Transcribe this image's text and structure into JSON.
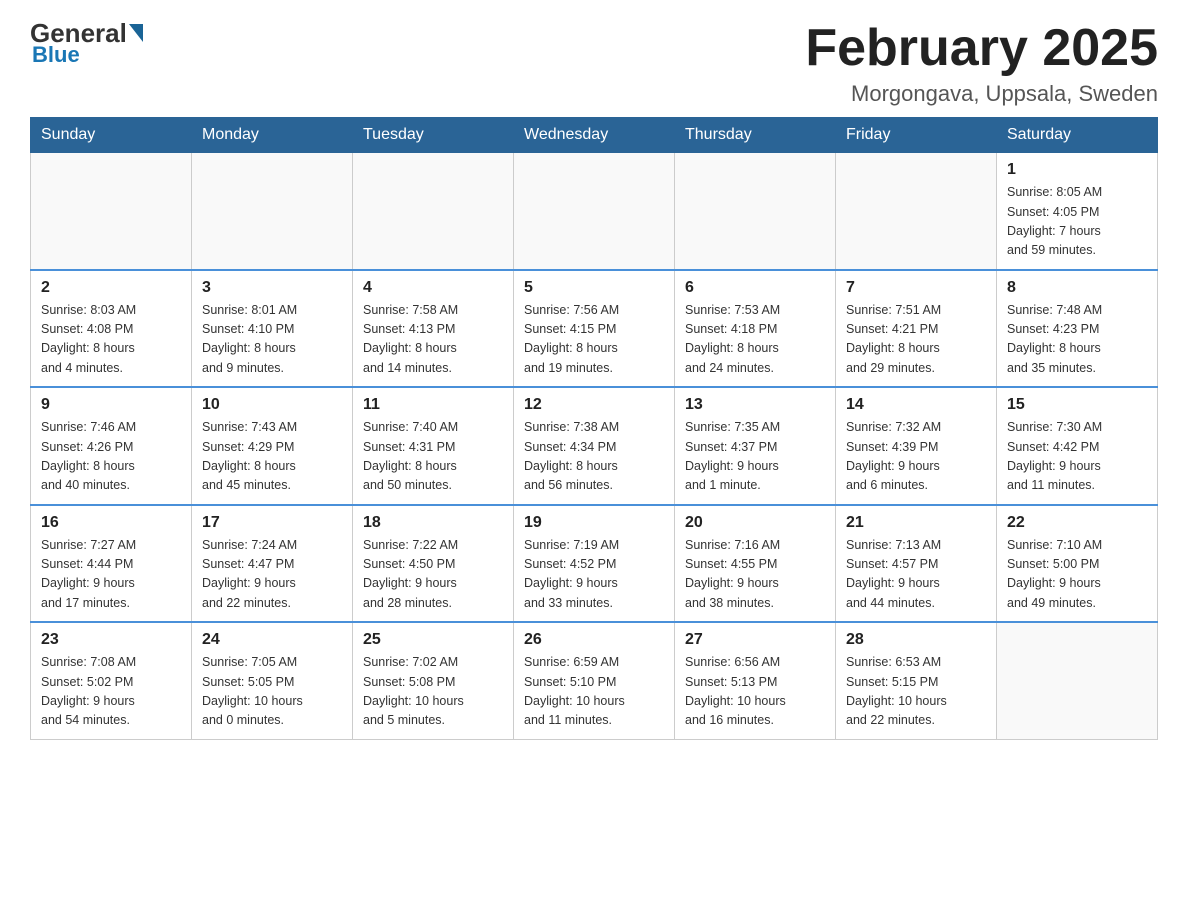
{
  "header": {
    "logo": {
      "general": "General",
      "blue": "Blue"
    },
    "title": "February 2025",
    "location": "Morgongava, Uppsala, Sweden"
  },
  "weekdays": [
    "Sunday",
    "Monday",
    "Tuesday",
    "Wednesday",
    "Thursday",
    "Friday",
    "Saturday"
  ],
  "weeks": [
    [
      {
        "day": "",
        "info": ""
      },
      {
        "day": "",
        "info": ""
      },
      {
        "day": "",
        "info": ""
      },
      {
        "day": "",
        "info": ""
      },
      {
        "day": "",
        "info": ""
      },
      {
        "day": "",
        "info": ""
      },
      {
        "day": "1",
        "info": "Sunrise: 8:05 AM\nSunset: 4:05 PM\nDaylight: 7 hours\nand 59 minutes."
      }
    ],
    [
      {
        "day": "2",
        "info": "Sunrise: 8:03 AM\nSunset: 4:08 PM\nDaylight: 8 hours\nand 4 minutes."
      },
      {
        "day": "3",
        "info": "Sunrise: 8:01 AM\nSunset: 4:10 PM\nDaylight: 8 hours\nand 9 minutes."
      },
      {
        "day": "4",
        "info": "Sunrise: 7:58 AM\nSunset: 4:13 PM\nDaylight: 8 hours\nand 14 minutes."
      },
      {
        "day": "5",
        "info": "Sunrise: 7:56 AM\nSunset: 4:15 PM\nDaylight: 8 hours\nand 19 minutes."
      },
      {
        "day": "6",
        "info": "Sunrise: 7:53 AM\nSunset: 4:18 PM\nDaylight: 8 hours\nand 24 minutes."
      },
      {
        "day": "7",
        "info": "Sunrise: 7:51 AM\nSunset: 4:21 PM\nDaylight: 8 hours\nand 29 minutes."
      },
      {
        "day": "8",
        "info": "Sunrise: 7:48 AM\nSunset: 4:23 PM\nDaylight: 8 hours\nand 35 minutes."
      }
    ],
    [
      {
        "day": "9",
        "info": "Sunrise: 7:46 AM\nSunset: 4:26 PM\nDaylight: 8 hours\nand 40 minutes."
      },
      {
        "day": "10",
        "info": "Sunrise: 7:43 AM\nSunset: 4:29 PM\nDaylight: 8 hours\nand 45 minutes."
      },
      {
        "day": "11",
        "info": "Sunrise: 7:40 AM\nSunset: 4:31 PM\nDaylight: 8 hours\nand 50 minutes."
      },
      {
        "day": "12",
        "info": "Sunrise: 7:38 AM\nSunset: 4:34 PM\nDaylight: 8 hours\nand 56 minutes."
      },
      {
        "day": "13",
        "info": "Sunrise: 7:35 AM\nSunset: 4:37 PM\nDaylight: 9 hours\nand 1 minute."
      },
      {
        "day": "14",
        "info": "Sunrise: 7:32 AM\nSunset: 4:39 PM\nDaylight: 9 hours\nand 6 minutes."
      },
      {
        "day": "15",
        "info": "Sunrise: 7:30 AM\nSunset: 4:42 PM\nDaylight: 9 hours\nand 11 minutes."
      }
    ],
    [
      {
        "day": "16",
        "info": "Sunrise: 7:27 AM\nSunset: 4:44 PM\nDaylight: 9 hours\nand 17 minutes."
      },
      {
        "day": "17",
        "info": "Sunrise: 7:24 AM\nSunset: 4:47 PM\nDaylight: 9 hours\nand 22 minutes."
      },
      {
        "day": "18",
        "info": "Sunrise: 7:22 AM\nSunset: 4:50 PM\nDaylight: 9 hours\nand 28 minutes."
      },
      {
        "day": "19",
        "info": "Sunrise: 7:19 AM\nSunset: 4:52 PM\nDaylight: 9 hours\nand 33 minutes."
      },
      {
        "day": "20",
        "info": "Sunrise: 7:16 AM\nSunset: 4:55 PM\nDaylight: 9 hours\nand 38 minutes."
      },
      {
        "day": "21",
        "info": "Sunrise: 7:13 AM\nSunset: 4:57 PM\nDaylight: 9 hours\nand 44 minutes."
      },
      {
        "day": "22",
        "info": "Sunrise: 7:10 AM\nSunset: 5:00 PM\nDaylight: 9 hours\nand 49 minutes."
      }
    ],
    [
      {
        "day": "23",
        "info": "Sunrise: 7:08 AM\nSunset: 5:02 PM\nDaylight: 9 hours\nand 54 minutes."
      },
      {
        "day": "24",
        "info": "Sunrise: 7:05 AM\nSunset: 5:05 PM\nDaylight: 10 hours\nand 0 minutes."
      },
      {
        "day": "25",
        "info": "Sunrise: 7:02 AM\nSunset: 5:08 PM\nDaylight: 10 hours\nand 5 minutes."
      },
      {
        "day": "26",
        "info": "Sunrise: 6:59 AM\nSunset: 5:10 PM\nDaylight: 10 hours\nand 11 minutes."
      },
      {
        "day": "27",
        "info": "Sunrise: 6:56 AM\nSunset: 5:13 PM\nDaylight: 10 hours\nand 16 minutes."
      },
      {
        "day": "28",
        "info": "Sunrise: 6:53 AM\nSunset: 5:15 PM\nDaylight: 10 hours\nand 22 minutes."
      },
      {
        "day": "",
        "info": ""
      }
    ]
  ]
}
